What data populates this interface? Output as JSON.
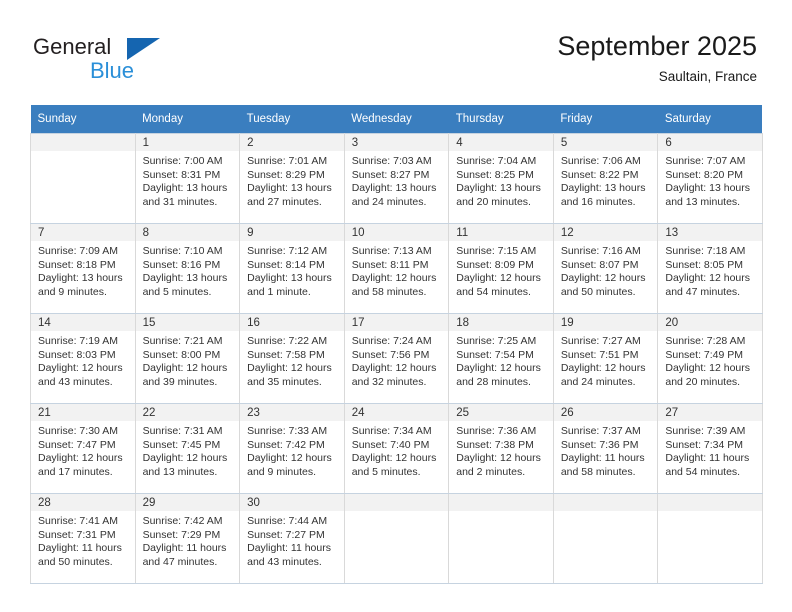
{
  "brand": {
    "name_top": "General",
    "name_bottom": "Blue",
    "triangle_color": "#1565b0",
    "blue_text_color": "#2a8fd8"
  },
  "header": {
    "title": "September 2025",
    "subtitle": "Saultain, France"
  },
  "theme": {
    "header_row_bg": "#3a7ebf",
    "header_row_text": "#ffffff",
    "daynum_band_bg": "#f2f2f2",
    "cell_border": "#d9d9d9"
  },
  "weekdays": [
    "Sunday",
    "Monday",
    "Tuesday",
    "Wednesday",
    "Thursday",
    "Friday",
    "Saturday"
  ],
  "weeks": [
    [
      {
        "day": "",
        "sunrise": "",
        "sunset": "",
        "daylight1": "",
        "daylight2": "",
        "empty": true
      },
      {
        "day": "1",
        "sunrise": "Sunrise: 7:00 AM",
        "sunset": "Sunset: 8:31 PM",
        "daylight1": "Daylight: 13 hours",
        "daylight2": "and 31 minutes."
      },
      {
        "day": "2",
        "sunrise": "Sunrise: 7:01 AM",
        "sunset": "Sunset: 8:29 PM",
        "daylight1": "Daylight: 13 hours",
        "daylight2": "and 27 minutes."
      },
      {
        "day": "3",
        "sunrise": "Sunrise: 7:03 AM",
        "sunset": "Sunset: 8:27 PM",
        "daylight1": "Daylight: 13 hours",
        "daylight2": "and 24 minutes."
      },
      {
        "day": "4",
        "sunrise": "Sunrise: 7:04 AM",
        "sunset": "Sunset: 8:25 PM",
        "daylight1": "Daylight: 13 hours",
        "daylight2": "and 20 minutes."
      },
      {
        "day": "5",
        "sunrise": "Sunrise: 7:06 AM",
        "sunset": "Sunset: 8:22 PM",
        "daylight1": "Daylight: 13 hours",
        "daylight2": "and 16 minutes."
      },
      {
        "day": "6",
        "sunrise": "Sunrise: 7:07 AM",
        "sunset": "Sunset: 8:20 PM",
        "daylight1": "Daylight: 13 hours",
        "daylight2": "and 13 minutes."
      }
    ],
    [
      {
        "day": "7",
        "sunrise": "Sunrise: 7:09 AM",
        "sunset": "Sunset: 8:18 PM",
        "daylight1": "Daylight: 13 hours",
        "daylight2": "and 9 minutes."
      },
      {
        "day": "8",
        "sunrise": "Sunrise: 7:10 AM",
        "sunset": "Sunset: 8:16 PM",
        "daylight1": "Daylight: 13 hours",
        "daylight2": "and 5 minutes."
      },
      {
        "day": "9",
        "sunrise": "Sunrise: 7:12 AM",
        "sunset": "Sunset: 8:14 PM",
        "daylight1": "Daylight: 13 hours",
        "daylight2": "and 1 minute."
      },
      {
        "day": "10",
        "sunrise": "Sunrise: 7:13 AM",
        "sunset": "Sunset: 8:11 PM",
        "daylight1": "Daylight: 12 hours",
        "daylight2": "and 58 minutes."
      },
      {
        "day": "11",
        "sunrise": "Sunrise: 7:15 AM",
        "sunset": "Sunset: 8:09 PM",
        "daylight1": "Daylight: 12 hours",
        "daylight2": "and 54 minutes."
      },
      {
        "day": "12",
        "sunrise": "Sunrise: 7:16 AM",
        "sunset": "Sunset: 8:07 PM",
        "daylight1": "Daylight: 12 hours",
        "daylight2": "and 50 minutes."
      },
      {
        "day": "13",
        "sunrise": "Sunrise: 7:18 AM",
        "sunset": "Sunset: 8:05 PM",
        "daylight1": "Daylight: 12 hours",
        "daylight2": "and 47 minutes."
      }
    ],
    [
      {
        "day": "14",
        "sunrise": "Sunrise: 7:19 AM",
        "sunset": "Sunset: 8:03 PM",
        "daylight1": "Daylight: 12 hours",
        "daylight2": "and 43 minutes."
      },
      {
        "day": "15",
        "sunrise": "Sunrise: 7:21 AM",
        "sunset": "Sunset: 8:00 PM",
        "daylight1": "Daylight: 12 hours",
        "daylight2": "and 39 minutes."
      },
      {
        "day": "16",
        "sunrise": "Sunrise: 7:22 AM",
        "sunset": "Sunset: 7:58 PM",
        "daylight1": "Daylight: 12 hours",
        "daylight2": "and 35 minutes."
      },
      {
        "day": "17",
        "sunrise": "Sunrise: 7:24 AM",
        "sunset": "Sunset: 7:56 PM",
        "daylight1": "Daylight: 12 hours",
        "daylight2": "and 32 minutes."
      },
      {
        "day": "18",
        "sunrise": "Sunrise: 7:25 AM",
        "sunset": "Sunset: 7:54 PM",
        "daylight1": "Daylight: 12 hours",
        "daylight2": "and 28 minutes."
      },
      {
        "day": "19",
        "sunrise": "Sunrise: 7:27 AM",
        "sunset": "Sunset: 7:51 PM",
        "daylight1": "Daylight: 12 hours",
        "daylight2": "and 24 minutes."
      },
      {
        "day": "20",
        "sunrise": "Sunrise: 7:28 AM",
        "sunset": "Sunset: 7:49 PM",
        "daylight1": "Daylight: 12 hours",
        "daylight2": "and 20 minutes."
      }
    ],
    [
      {
        "day": "21",
        "sunrise": "Sunrise: 7:30 AM",
        "sunset": "Sunset: 7:47 PM",
        "daylight1": "Daylight: 12 hours",
        "daylight2": "and 17 minutes."
      },
      {
        "day": "22",
        "sunrise": "Sunrise: 7:31 AM",
        "sunset": "Sunset: 7:45 PM",
        "daylight1": "Daylight: 12 hours",
        "daylight2": "and 13 minutes."
      },
      {
        "day": "23",
        "sunrise": "Sunrise: 7:33 AM",
        "sunset": "Sunset: 7:42 PM",
        "daylight1": "Daylight: 12 hours",
        "daylight2": "and 9 minutes."
      },
      {
        "day": "24",
        "sunrise": "Sunrise: 7:34 AM",
        "sunset": "Sunset: 7:40 PM",
        "daylight1": "Daylight: 12 hours",
        "daylight2": "and 5 minutes."
      },
      {
        "day": "25",
        "sunrise": "Sunrise: 7:36 AM",
        "sunset": "Sunset: 7:38 PM",
        "daylight1": "Daylight: 12 hours",
        "daylight2": "and 2 minutes."
      },
      {
        "day": "26",
        "sunrise": "Sunrise: 7:37 AM",
        "sunset": "Sunset: 7:36 PM",
        "daylight1": "Daylight: 11 hours",
        "daylight2": "and 58 minutes."
      },
      {
        "day": "27",
        "sunrise": "Sunrise: 7:39 AM",
        "sunset": "Sunset: 7:34 PM",
        "daylight1": "Daylight: 11 hours",
        "daylight2": "and 54 minutes."
      }
    ],
    [
      {
        "day": "28",
        "sunrise": "Sunrise: 7:41 AM",
        "sunset": "Sunset: 7:31 PM",
        "daylight1": "Daylight: 11 hours",
        "daylight2": "and 50 minutes."
      },
      {
        "day": "29",
        "sunrise": "Sunrise: 7:42 AM",
        "sunset": "Sunset: 7:29 PM",
        "daylight1": "Daylight: 11 hours",
        "daylight2": "and 47 minutes."
      },
      {
        "day": "30",
        "sunrise": "Sunrise: 7:44 AM",
        "sunset": "Sunset: 7:27 PM",
        "daylight1": "Daylight: 11 hours",
        "daylight2": "and 43 minutes."
      },
      {
        "day": "",
        "sunrise": "",
        "sunset": "",
        "daylight1": "",
        "daylight2": "",
        "empty": true
      },
      {
        "day": "",
        "sunrise": "",
        "sunset": "",
        "daylight1": "",
        "daylight2": "",
        "empty": true
      },
      {
        "day": "",
        "sunrise": "",
        "sunset": "",
        "daylight1": "",
        "daylight2": "",
        "empty": true
      },
      {
        "day": "",
        "sunrise": "",
        "sunset": "",
        "daylight1": "",
        "daylight2": "",
        "empty": true
      }
    ]
  ]
}
